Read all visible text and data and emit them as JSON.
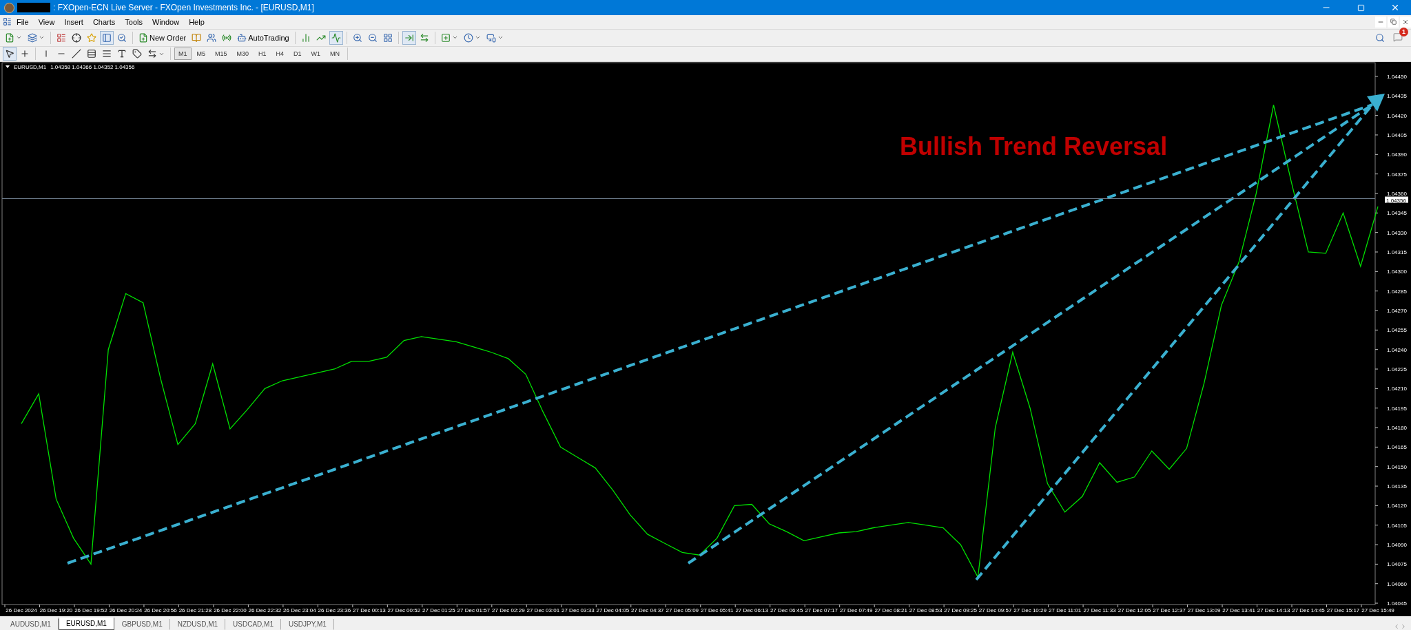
{
  "window": {
    "title": ": FXOpen-ECN Live Server - FXOpen Investments Inc. - [EURUSD,M1]"
  },
  "menu": [
    "File",
    "View",
    "Insert",
    "Charts",
    "Tools",
    "Window",
    "Help"
  ],
  "toolbar": {
    "new_order": "New Order",
    "auto_trading": "AutoTrading",
    "notification_badge": "1"
  },
  "timeframes": [
    {
      "label": "M1",
      "selected": true
    },
    {
      "label": "M5",
      "selected": false
    },
    {
      "label": "M15",
      "selected": false
    },
    {
      "label": "M30",
      "selected": false
    },
    {
      "label": "H1",
      "selected": false
    },
    {
      "label": "H4",
      "selected": false
    },
    {
      "label": "D1",
      "selected": false
    },
    {
      "label": "W1",
      "selected": false
    },
    {
      "label": "MN",
      "selected": false
    }
  ],
  "chart": {
    "legend": {
      "symbol": "EURUSD,M1",
      "quotes": "1.04358 1.04366 1.04352 1.04356"
    },
    "bid_price": {
      "label": "1.04356"
    },
    "chart_data": {
      "type": "line",
      "ylim": [
        1.040445,
        1.044611
      ],
      "yticks": [
        {
          "value": 1.0445,
          "label": "1.04450"
        },
        {
          "value": 1.04435,
          "label": "1.04435"
        },
        {
          "value": 1.0442,
          "label": "1.04420"
        },
        {
          "value": 1.04405,
          "label": "1.04405"
        },
        {
          "value": 1.0439,
          "label": "1.04390"
        },
        {
          "value": 1.04375,
          "label": "1.04375"
        },
        {
          "value": 1.0436,
          "label": "1.04360"
        },
        {
          "value": 1.04345,
          "label": "1.04345"
        },
        {
          "value": 1.0433,
          "label": "1.04330"
        },
        {
          "value": 1.04315,
          "label": "1.04315"
        },
        {
          "value": 1.043,
          "label": "1.04300"
        },
        {
          "value": 1.04285,
          "label": "1.04285"
        },
        {
          "value": 1.0427,
          "label": "1.04270"
        },
        {
          "value": 1.04255,
          "label": "1.04255"
        },
        {
          "value": 1.0424,
          "label": "1.04240"
        },
        {
          "value": 1.04225,
          "label": "1.04225"
        },
        {
          "value": 1.0421,
          "label": "1.04210"
        },
        {
          "value": 1.04195,
          "label": "1.04195"
        },
        {
          "value": 1.0418,
          "label": "1.04180"
        },
        {
          "value": 1.04165,
          "label": "1.04165"
        },
        {
          "value": 1.0415,
          "label": "1.04150"
        },
        {
          "value": 1.04135,
          "label": "1.04135"
        },
        {
          "value": 1.0412,
          "label": "1.04120"
        },
        {
          "value": 1.04105,
          "label": "1.04105"
        },
        {
          "value": 1.0409,
          "label": "1.04090"
        },
        {
          "value": 1.04075,
          "label": "1.04075"
        },
        {
          "value": 1.0406,
          "label": "1.04060"
        },
        {
          "value": 1.04045,
          "label": "1.04045"
        }
      ],
      "categories": [
        "26 Dec 2024",
        null,
        "26 Dec 19:20",
        null,
        "26 Dec 19:52",
        null,
        "26 Dec 20:24",
        null,
        "26 Dec 20:56",
        null,
        "26 Dec 21:28",
        null,
        "26 Dec 22:00",
        null,
        "26 Dec 22:32",
        null,
        "26 Dec 23:04",
        null,
        "26 Dec 23:36",
        null,
        "27 Dec 00:13",
        null,
        "27 Dec 00:52",
        null,
        "27 Dec 01:25",
        null,
        "27 Dec 01:57",
        null,
        "27 Dec 02:29",
        null,
        "27 Dec 03:01",
        null,
        "27 Dec 03:33",
        null,
        "27 Dec 04:05",
        null,
        "27 Dec 04:37",
        null,
        "27 Dec 05:09",
        null,
        "27 Dec 05:41",
        null,
        "27 Dec 06:13",
        null,
        "27 Dec 06:45",
        null,
        "27 Dec 07:17",
        null,
        "27 Dec 07:49",
        null,
        "27 Dec 08:21",
        null,
        "27 Dec 08:53",
        null,
        "27 Dec 09:25",
        null,
        "27 Dec 09:57",
        null,
        "27 Dec 10:29",
        null,
        "27 Dec 11:01",
        null,
        "27 Dec 11:33",
        null,
        "27 Dec 12:05",
        null,
        "27 Dec 12:37",
        null,
        "27 Dec 13:09",
        null,
        "27 Dec 13:41",
        null,
        "27 Dec 14:13",
        null,
        "27 Dec 14:45",
        null,
        "27 Dec 15:17",
        null,
        "27 Dec 15:49"
      ],
      "series": [
        {
          "color": "#00e000",
          "values": [
            1.04183,
            1.04206,
            1.04125,
            1.04095,
            1.04075,
            1.0424,
            1.04283,
            1.04276,
            1.04218,
            1.04167,
            1.04183,
            1.04229,
            1.04179,
            1.04194,
            1.0421,
            1.04216,
            1.04219,
            1.04222,
            1.04225,
            1.04231,
            1.04231,
            1.04234,
            1.04247,
            1.0425,
            1.04248,
            1.04246,
            1.04242,
            1.04238,
            1.04233,
            1.04221,
            1.04192,
            1.04165,
            1.04157,
            1.04149,
            1.04132,
            1.04113,
            1.04098,
            1.04091,
            1.04084,
            1.04082,
            1.04095,
            1.0412,
            1.04121,
            1.04106,
            1.041,
            1.04093,
            1.04096,
            1.04099,
            1.041,
            1.04103,
            1.04105,
            1.04107,
            1.04105,
            1.04103,
            1.0409,
            1.04065,
            1.0418,
            1.04238,
            1.04195,
            1.04137,
            1.04115,
            1.04127,
            1.04153,
            1.04138,
            1.04142,
            1.04162,
            1.04148,
            1.04164,
            1.04214,
            1.04274,
            1.04307,
            1.0436,
            1.04428,
            1.0437,
            1.04315,
            1.04314,
            1.04345,
            1.04304,
            1.0435
          ]
        }
      ],
      "annotations": [
        {
          "text": "Bullish Trend Reversal"
        }
      ]
    }
  },
  "symbol_tabs": [
    {
      "label": "AUDUSD,M1",
      "selected": false
    },
    {
      "label": "EURUSD,M1",
      "selected": true
    },
    {
      "label": "GBPUSD,M1",
      "selected": false
    },
    {
      "label": "NZDUSD,M1",
      "selected": false
    },
    {
      "label": "USDCAD,M1",
      "selected": false
    },
    {
      "label": "USDJPY,M1",
      "selected": false
    }
  ]
}
